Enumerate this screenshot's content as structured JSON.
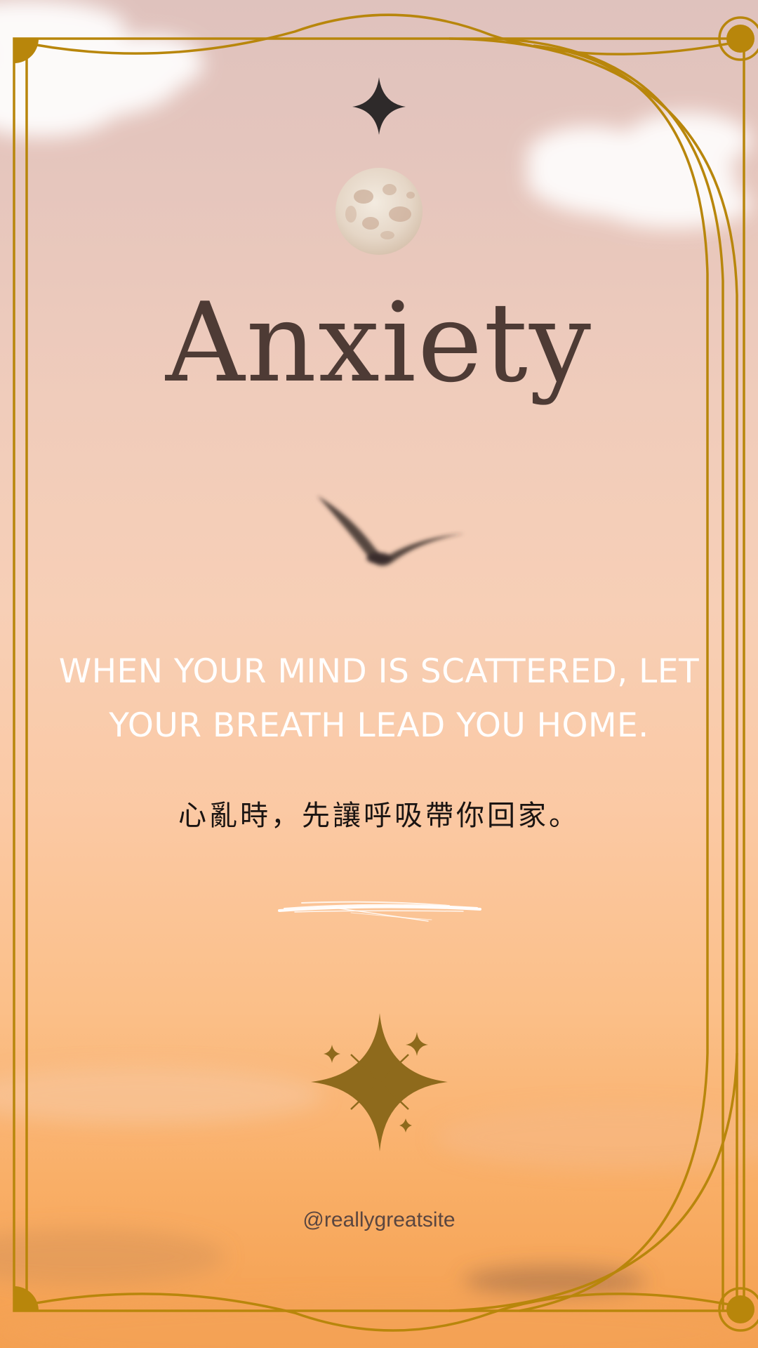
{
  "poster": {
    "title": "Anxiety",
    "quote_en": "WHEN YOUR MIND IS SCATTERED, LET YOUR BREATH LEAD YOU HOME.",
    "quote_zh": "心亂時，先讓呼吸帶你回家。",
    "handle": "@reallygreatsite"
  },
  "colors": {
    "frame_gold": "#b8860b",
    "title_brown": "#4e3b35",
    "quote_white": "#ffffff",
    "quote_zh_black": "#1a1412",
    "sparkle_dark": "#2e2a2a"
  },
  "icons": {
    "top_star": "four-point-star-icon",
    "moon": "moon-icon",
    "bird": "bird-icon",
    "bottom_sparkles": "sparkle-cluster-icon",
    "brush_stroke": "brush-stroke-icon"
  }
}
